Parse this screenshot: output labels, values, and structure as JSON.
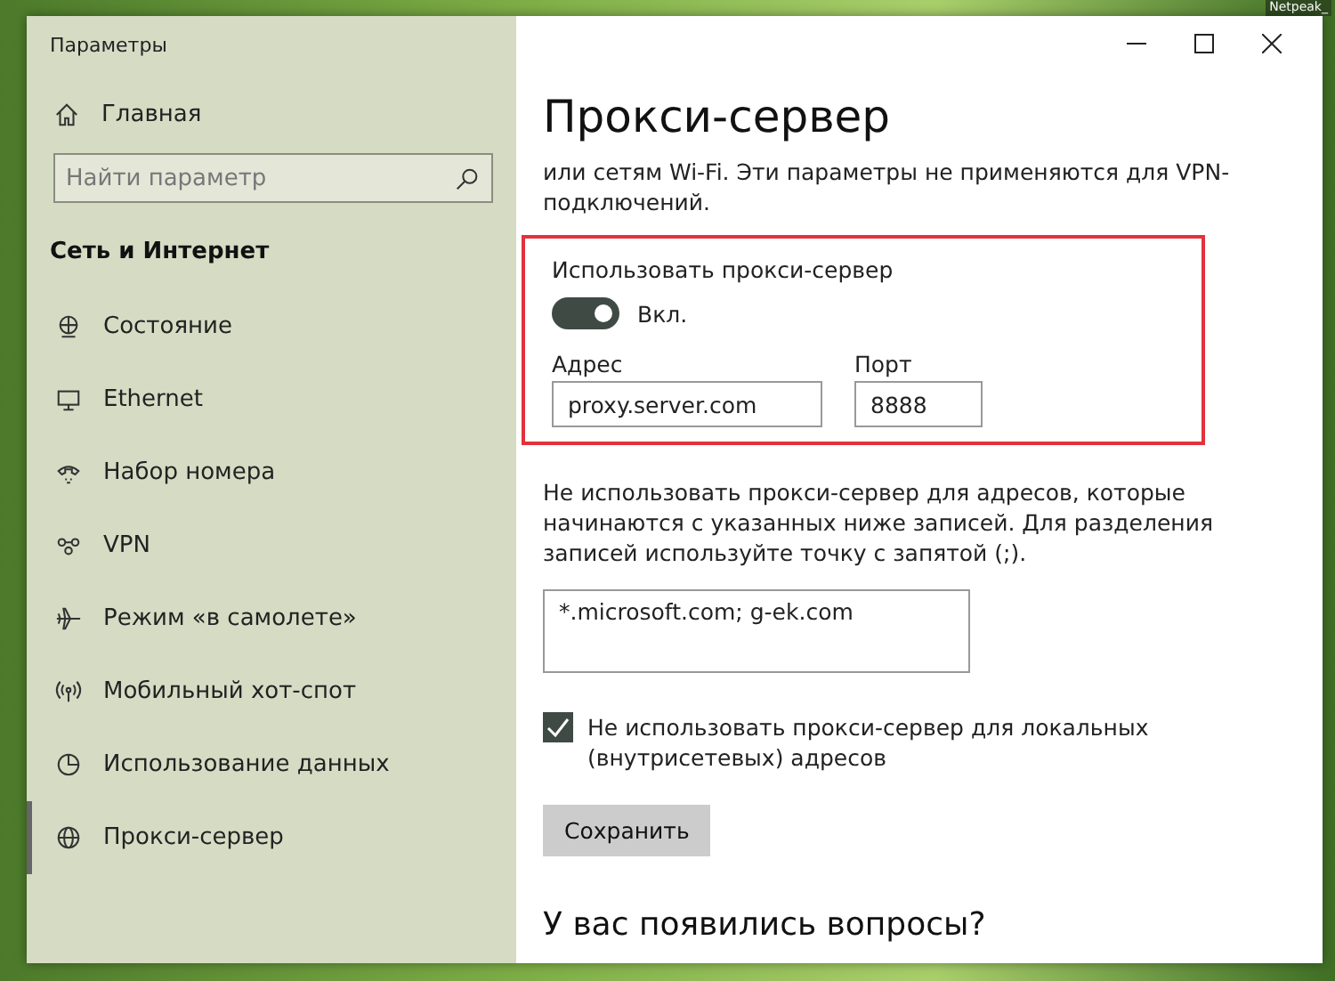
{
  "desktop": {
    "icon_label": "Netpeak_"
  },
  "window": {
    "title": "Параметры"
  },
  "sidebar": {
    "home": "Главная",
    "search": {
      "placeholder": "Найти параметр"
    },
    "section": "Сеть и Интернет",
    "items": [
      {
        "label": "Состояние",
        "selected": false
      },
      {
        "label": "Ethernet",
        "selected": false
      },
      {
        "label": "Набор номера",
        "selected": false
      },
      {
        "label": "VPN",
        "selected": false
      },
      {
        "label": "Режим «в самолете»",
        "selected": false
      },
      {
        "label": "Мобильный хот-спот",
        "selected": false
      },
      {
        "label": "Использование данных",
        "selected": false
      },
      {
        "label": "Прокси-сервер",
        "selected": true
      }
    ]
  },
  "content": {
    "title": "Прокси-сервер",
    "intro": "или сетям Wi-Fi. Эти параметры не применяются для VPN-подключений.",
    "use_proxy": {
      "label": "Использовать прокси-сервер",
      "on": true,
      "state_text": "Вкл."
    },
    "address": {
      "label": "Адрес",
      "value": "proxy.server.com"
    },
    "port": {
      "label": "Порт",
      "value": "8888"
    },
    "exceptions_text": "Не использовать прокси-сервер для адресов, которые начинаются с указанных ниже записей. Для разделения записей используйте точку с запятой (;).",
    "exceptions_value": "*.microsoft.com; g-ek.com",
    "bypass_local": {
      "label": "Не использовать прокси-сервер для локальных (внутрисетевых) адресов",
      "checked": true
    },
    "save_button": "Сохранить",
    "help_heading": "У вас появились вопросы?"
  }
}
